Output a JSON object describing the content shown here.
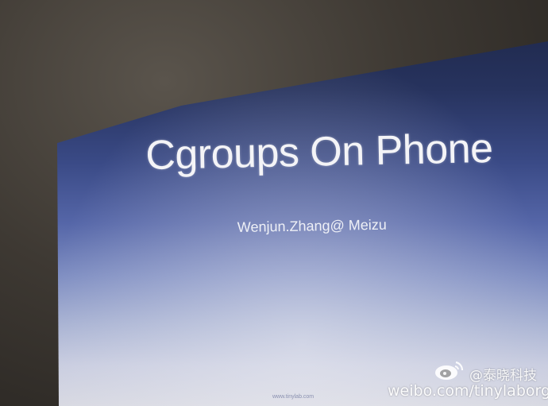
{
  "slide": {
    "title": "Cgroups On Phone",
    "subtitle": "Wenjun.Zhang@ Meizu",
    "footer": "www.tinylab.com"
  },
  "watermark": {
    "logo_icon": "weibo-logo-icon",
    "handle": "@泰晓科技",
    "url": "weibo.com/tinylaborg"
  },
  "colors": {
    "slide_top": "#1c2546",
    "slide_bottom": "#d8d9e2",
    "text": "#f4f4f7"
  }
}
